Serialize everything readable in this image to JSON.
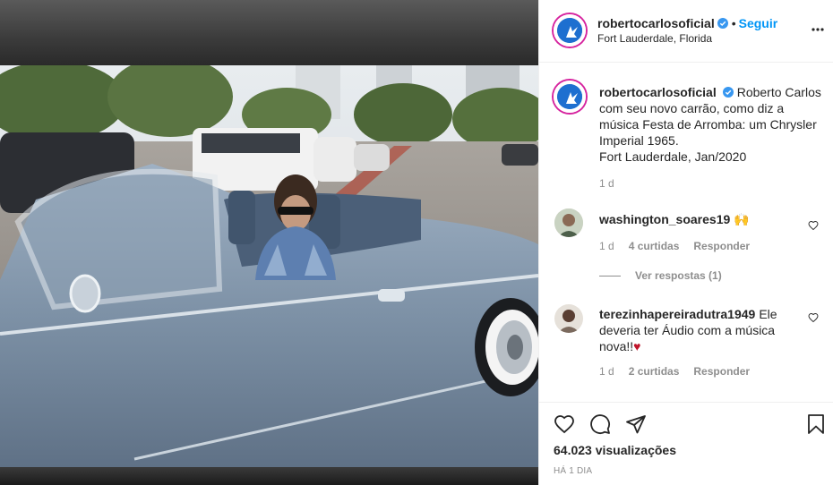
{
  "post": {
    "author": "robertocarlosoficial",
    "follow_label": "Seguir",
    "separator": "•",
    "location": "Fort Lauderdale, Florida"
  },
  "caption": {
    "username": "robertocarlosoficial",
    "line1": "Roberto Carlos",
    "line2": "com seu novo carrão, como diz a",
    "line3": "música Festa de Arromba: um Chrysler",
    "line4": "Imperial 1965.",
    "line5": "Fort Lauderdale, Jan/2020",
    "age": "1 d"
  },
  "comments": [
    {
      "username": "washington_soares19",
      "text": "🙌",
      "age": "1 d",
      "likes": "4 curtidas",
      "reply_label": "Responder",
      "view_replies": "Ver respostas (1)"
    },
    {
      "username": "terezinhapereiradutra1949",
      "text_line1": "Ele",
      "text_line2": "deveria ter Áudio com a música",
      "text_line3": "nova!!",
      "emoji": "♥",
      "age": "1 d",
      "likes": "2 curtidas",
      "reply_label": "Responder"
    }
  ],
  "footer": {
    "views": "64.023 visualizações",
    "time": "HÁ 1 DIA"
  },
  "icons": {
    "verified": "verified-badge-icon",
    "more": "more-options-icon",
    "like": "heart-icon",
    "comment": "comment-icon",
    "share": "share-icon",
    "save": "bookmark-icon"
  },
  "colors": {
    "accent": "#0095f6",
    "text": "#262626",
    "secondary": "#8e8e8e",
    "story_ring": "#d6249f",
    "emoji_heart": "#c0142a"
  }
}
